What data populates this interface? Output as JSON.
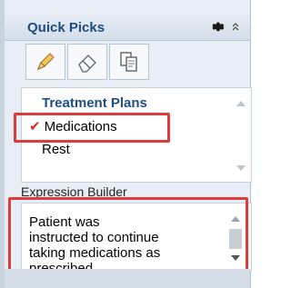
{
  "panel": {
    "title": "Quick Picks",
    "gear_icon": "gear-icon",
    "collapse_icon": "collapse-icon"
  },
  "toolbar": {
    "tools": [
      "pencil-icon",
      "eraser-icon",
      "copy-icon"
    ]
  },
  "quick_picks": {
    "items": [
      {
        "label": "Treatment Plans",
        "selected": false
      },
      {
        "label": "Medications",
        "selected": true
      },
      {
        "label": "Rest",
        "selected": false
      }
    ]
  },
  "expression_builder": {
    "label": "Expression Builder",
    "text": " Patient was\ninstructed to continue\ntaking medications as\nprescribed."
  },
  "colors": {
    "accent": "#1e4c7d",
    "highlight_box": "#e03b3b",
    "check": "#d42a2a"
  }
}
